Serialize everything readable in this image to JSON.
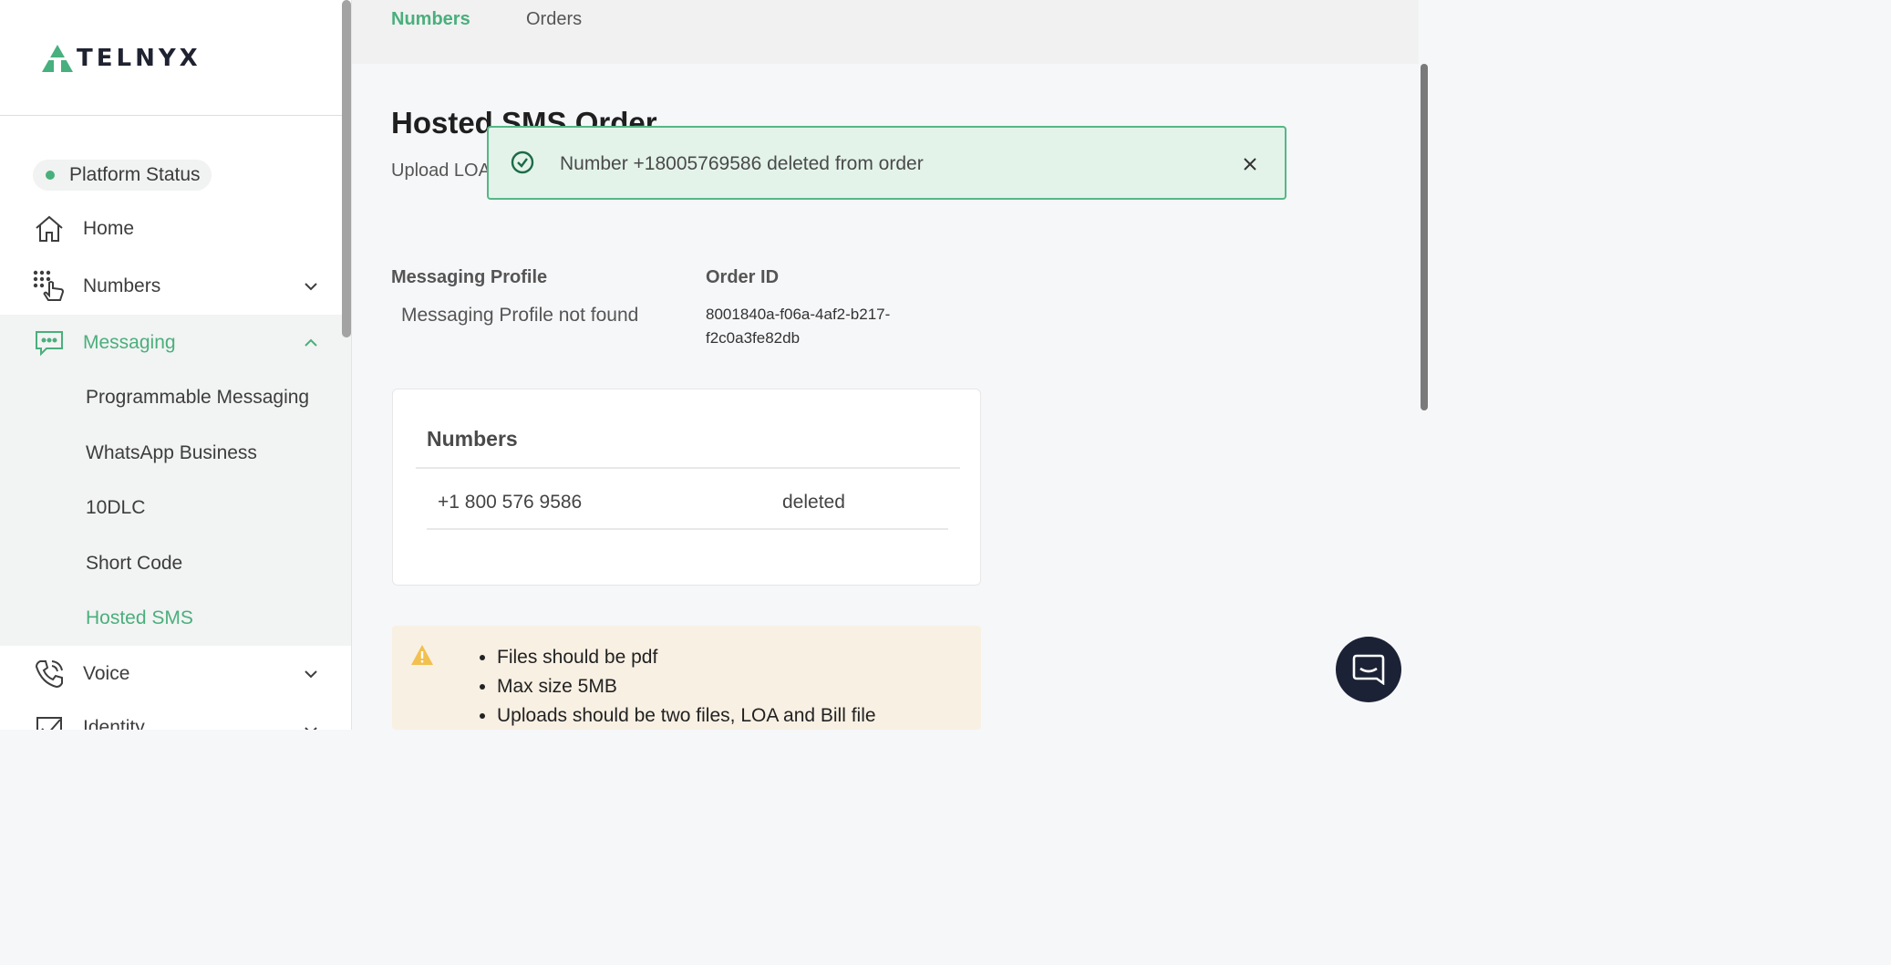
{
  "brand": {
    "name": "TELNYX",
    "accent": "#4aaf7c"
  },
  "sidebar": {
    "platform_status": "Platform Status",
    "items": [
      {
        "label": "Home",
        "icon": "home-icon"
      },
      {
        "label": "Numbers",
        "icon": "dialpad-icon"
      },
      {
        "label": "Messaging",
        "icon": "chat-icon"
      },
      {
        "label": "Voice",
        "icon": "phone-icon"
      },
      {
        "label": "Identity",
        "icon": "checkbox-icon"
      }
    ],
    "messaging_sub": [
      "Programmable Messaging",
      "WhatsApp Business",
      "10DLC",
      "Short Code",
      "Hosted SMS"
    ]
  },
  "tabs": {
    "numbers": "Numbers",
    "orders": "Orders"
  },
  "page": {
    "title": "Hosted SMS Order",
    "subtitle": "Upload LOA"
  },
  "toast": {
    "message": "Number +18005769586 deleted from order"
  },
  "details": {
    "messaging_profile_label": "Messaging Profile",
    "messaging_profile_value": "Messaging Profile not found",
    "order_id_label": "Order ID",
    "order_id_value": "8001840a-f06a-4af2-b217-f2c0a3fe82db"
  },
  "numbers_card": {
    "title": "Numbers",
    "rows": [
      {
        "number": "+1 800 576 9586",
        "status": "deleted"
      }
    ]
  },
  "upload_notes": [
    "Files should be pdf",
    "Max size 5MB",
    "Uploads should be two files, LOA and Bill file"
  ]
}
